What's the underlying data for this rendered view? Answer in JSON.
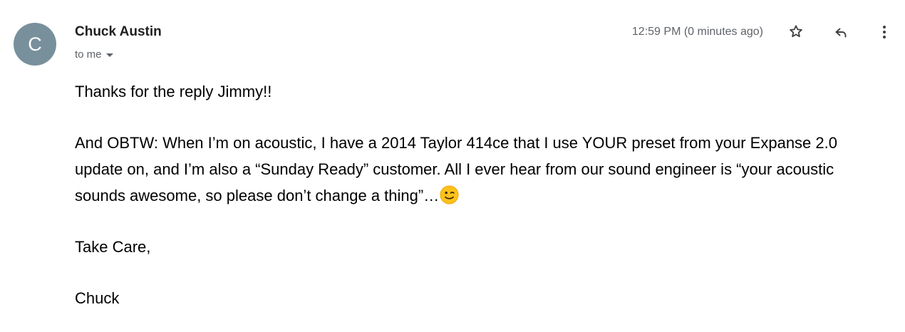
{
  "sender": {
    "avatar_letter": "C",
    "avatar_color": "#78909c",
    "name": "Chuck Austin",
    "recipient": "to me"
  },
  "meta": {
    "timestamp": "12:59 PM (0 minutes ago)"
  },
  "actions": {
    "star_icon": "star-outline-icon",
    "reply_icon": "reply-arrow-icon",
    "more_icon": "vertical-dots-icon"
  },
  "message": {
    "greeting": "Thanks for the reply Jimmy!!",
    "paragraph": "And OBTW:  When I’m on acoustic, I have a 2014 Taylor 414ce that I use YOUR preset from your Expanse 2.0 update on, and I’m also a “Sunday Ready” customer.  All I ever hear from our sound engineer is “your acoustic sounds awesome, so please don’t change a thing”…",
    "emoji": "winking-face-emoji",
    "closing": "Take Care,",
    "signature": "Chuck"
  }
}
